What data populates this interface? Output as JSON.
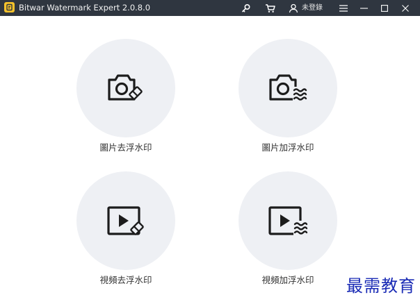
{
  "window": {
    "title": "Bitwar Watermark Expert  2.0.8.0",
    "login_label": "未登錄",
    "icons": [
      "key-icon",
      "cart-icon",
      "user-icon",
      "menu-icon",
      "minimize-icon",
      "maximize-icon",
      "close-icon"
    ]
  },
  "tools": [
    {
      "label": "圖片去浮水印",
      "icon": "photo-watermark-remove-icon"
    },
    {
      "label": "圖片加浮水印",
      "icon": "photo-watermark-add-icon"
    },
    {
      "label": "視頻去浮水印",
      "icon": "video-watermark-remove-icon"
    },
    {
      "label": "視頻加浮水印",
      "icon": "video-watermark-add-icon"
    }
  ],
  "overlay": {
    "text": "最需教育"
  },
  "colors": {
    "titlebar": "#2f3640",
    "logo": "#f5c22b",
    "circle": "#eef0f4",
    "overlay_text": "#1a2bb5"
  }
}
